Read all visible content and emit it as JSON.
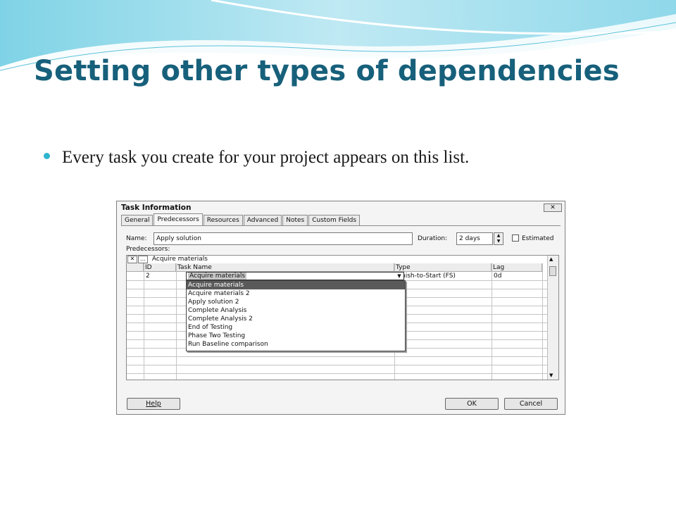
{
  "slide": {
    "title": "Setting other types of dependencies",
    "bullet": "Every task you create for your project appears on this list."
  },
  "colors": {
    "title": "#17607b",
    "bullet": "#2fb5cf",
    "wave_light": "#cfeef5",
    "wave_mid": "#7fd3e6"
  },
  "dialog": {
    "title": "Task Information",
    "close_icon": "close-icon",
    "tabs": [
      "General",
      "Predecessors",
      "Resources",
      "Advanced",
      "Notes",
      "Custom Fields"
    ],
    "active_tab": "Predecessors",
    "name_label": "Name:",
    "name_value": "Apply solution",
    "duration_label": "Duration:",
    "duration_value": "2 days",
    "estimated_label": "Estimated",
    "predecessors_label": "Predecessors:",
    "edit_value": "Acquire materials",
    "columns": {
      "id": "ID",
      "task_name": "Task Name",
      "type": "Type",
      "lag": "Lag"
    },
    "row": {
      "id": "2",
      "task_name": "Acquire materials",
      "type": "Finish-to-Start (FS)",
      "lag": "0d"
    },
    "dropdown_items": [
      "Acquire materials",
      "Acquire materials 2",
      "Apply solution 2",
      "Complete Analysis",
      "Complete Analysis 2",
      "End of Testing",
      "Phase Two Testing",
      "Run Baseline comparison"
    ],
    "help_label": "Help",
    "ok_label": "OK",
    "cancel_label": "Cancel"
  }
}
